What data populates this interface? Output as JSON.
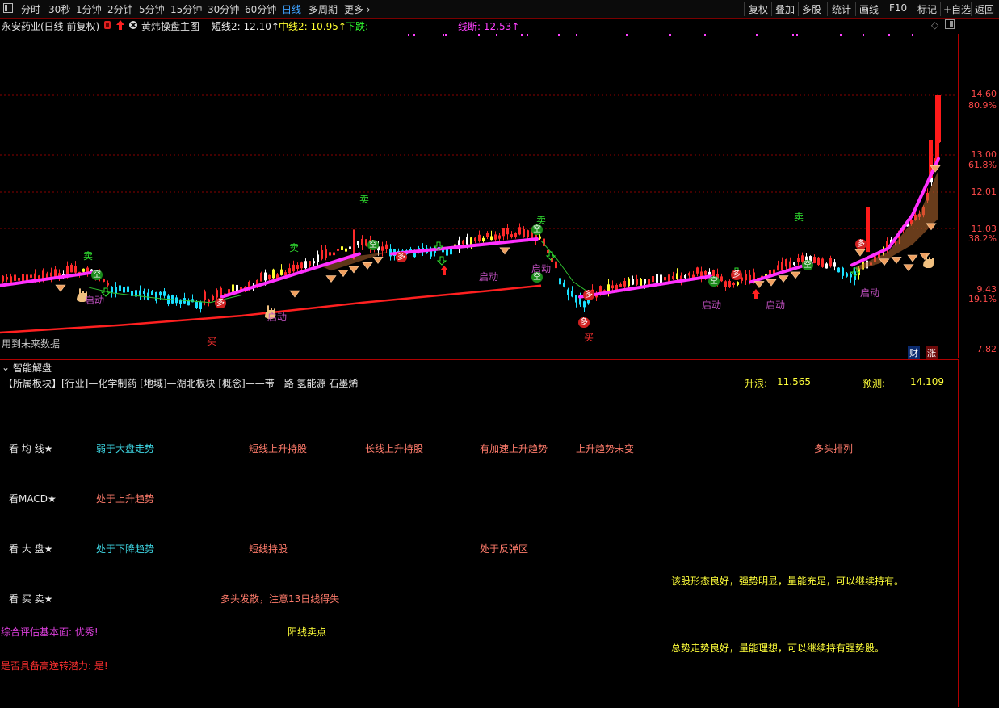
{
  "toolbar": {
    "periods": [
      "分时",
      "30秒",
      "1分钟",
      "2分钟",
      "5分钟",
      "15分钟",
      "30分钟",
      "60分钟",
      "日线",
      "多周期",
      "更多"
    ],
    "active_period": "日线",
    "right_buttons": [
      "复权",
      "叠加",
      "多股",
      "统计",
      "画线",
      "F10",
      "标记",
      "+自选",
      "返回"
    ]
  },
  "info": {
    "stock_title": "永安药业(日线 前复权)",
    "indicator_name": "黄炜操盘主图",
    "short_line": "短线2: 12.10↑",
    "mid_line": "中线2: 10.95↑",
    "down_label": "下跌: -",
    "line_break": "线断: 12.53↑"
  },
  "axis": {
    "labels": [
      {
        "text": "14.60",
        "color": "#ff4a4a"
      },
      {
        "text": "80.9%",
        "color": "#ff4a4a"
      },
      {
        "text": "13.00",
        "color": "#ff4a4a"
      },
      {
        "text": "61.8%",
        "color": "#ff4a4a"
      },
      {
        "text": "12.01",
        "color": "#ff4a4a"
      },
      {
        "text": "11.03",
        "color": "#ff4a4a"
      },
      {
        "text": "38.2%",
        "color": "#ff4a4a"
      },
      {
        "text": "9.43",
        "color": "#ff4a4a"
      },
      {
        "text": "19.1%",
        "color": "#ff4a4a"
      },
      {
        "text": "7.82",
        "color": "#ff4a4a"
      }
    ]
  },
  "chart_notes": {
    "future_data": "用到未来数据",
    "badge_cai": "财",
    "badge_zhang": "涨"
  },
  "chart_markers": {
    "sell": "卖",
    "buy": "买",
    "start": "启动",
    "empty": "空",
    "more": "多"
  },
  "chart_data": {
    "type": "candlestick",
    "title": "",
    "ylim": [
      7.82,
      14.6
    ],
    "price_levels": [
      14.6,
      13.0,
      12.01,
      11.03,
      9.43,
      7.82
    ]
  },
  "panel": {
    "title": "智能解盘",
    "sector_line": "【所属板块】[行业]—化学制药 [地域]—湖北板块 [概念]——带一路 氢能源 石墨烯",
    "rise_label": "升浪:",
    "rise_value": "11.565",
    "predict_label": "预测:",
    "predict_value": "14.109",
    "ma_label": "看 均 线★",
    "ma_items": [
      "弱于大盘走势",
      "短线上升持股",
      "长线上升持股",
      "有加速上升趋势",
      "上升趋势未变",
      "多头排列"
    ],
    "macd_label": "看MACD★",
    "macd_item": "处于上升趋势",
    "market_label": "看 大 盘★",
    "market_items": [
      "处于下降趋势",
      "短线持股",
      "处于反弹区"
    ],
    "trade_label": "看 买 卖★",
    "trade_item": "多头发散，注意13日线得失",
    "comment1": "该股形态良好，强势明显，量能充足，可以继续持有。",
    "fundamental": "综合评估基本面: 优秀!",
    "sun_sell": "阳线卖点",
    "comment2": "总势走势良好，量能理想，可以继续持有强势股。",
    "potential": "是否具备高送转潜力: 是!"
  }
}
